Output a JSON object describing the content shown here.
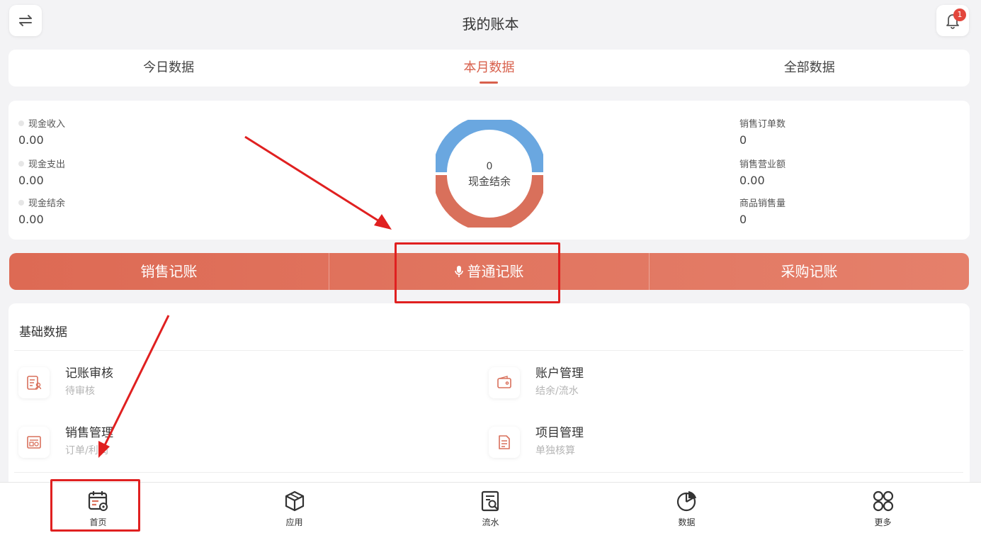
{
  "header": {
    "title": "我的账本",
    "notification_count": "1"
  },
  "tabs": [
    {
      "label": "今日数据",
      "active": false
    },
    {
      "label": "本月数据",
      "active": true
    },
    {
      "label": "全部数据",
      "active": false
    }
  ],
  "stats": {
    "left": [
      {
        "label": "现金收入",
        "value": "0.00"
      },
      {
        "label": "现金支出",
        "value": "0.00"
      },
      {
        "label": "现金结余",
        "value": "0.00"
      }
    ],
    "right": [
      {
        "label": "销售订单数",
        "value": "0"
      },
      {
        "label": "销售营业额",
        "value": "0.00"
      },
      {
        "label": "商品销售量",
        "value": "0"
      }
    ],
    "donut": {
      "value": "0",
      "label": "现金结余",
      "colors": {
        "top": "#6aa7e0",
        "bottom": "#d9705b"
      }
    }
  },
  "actions": [
    {
      "label": "销售记账"
    },
    {
      "label": "普通记账"
    },
    {
      "label": "采购记账"
    }
  ],
  "basic": {
    "title": "基础数据",
    "items": [
      {
        "name": "记账审核",
        "sub": "待审核",
        "icon": "review-icon"
      },
      {
        "name": "账户管理",
        "sub": "结余/流水",
        "icon": "wallet-icon"
      },
      {
        "name": "销售管理",
        "sub": "订单/利润",
        "icon": "sales-icon"
      },
      {
        "name": "项目管理",
        "sub": "单独核算",
        "icon": "project-icon"
      }
    ]
  },
  "nav": [
    {
      "label": "首页",
      "icon": "calendar-gear-icon"
    },
    {
      "label": "应用",
      "icon": "box-icon"
    },
    {
      "label": "流水",
      "icon": "ledger-search-icon"
    },
    {
      "label": "数据",
      "icon": "pie-chart-icon"
    },
    {
      "label": "更多",
      "icon": "grid-icon"
    }
  ],
  "colors": {
    "accent": "#d8604c",
    "highlight": "#e02020"
  }
}
